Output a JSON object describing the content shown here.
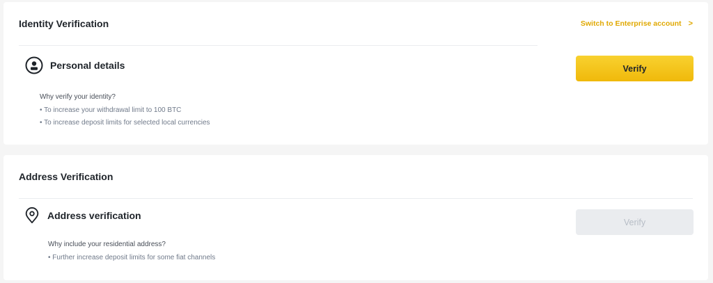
{
  "identity": {
    "title": "Identity Verification",
    "enterprise_link": "Switch to Enterprise account",
    "enterprise_chevron": ">",
    "section_icon": "user-circle-icon",
    "section_title": "Personal details",
    "verify_label": "Verify",
    "question": "Why verify your identity?",
    "bullets": [
      "• To increase your withdrawal limit to 100 BTC",
      "• To increase deposit limits for selected local currencies"
    ]
  },
  "address": {
    "title": "Address Verification",
    "section_icon": "map-pin-icon",
    "section_title": "Address verification",
    "verify_label": "Verify",
    "question": "Why include your residential address?",
    "bullets": [
      "• Further increase deposit limits for some fiat channels"
    ]
  },
  "colors": {
    "accent": "#F0B90B",
    "link": "#E0A800",
    "disabled_bg": "#EAECEF",
    "disabled_text": "#B7BDC6"
  }
}
